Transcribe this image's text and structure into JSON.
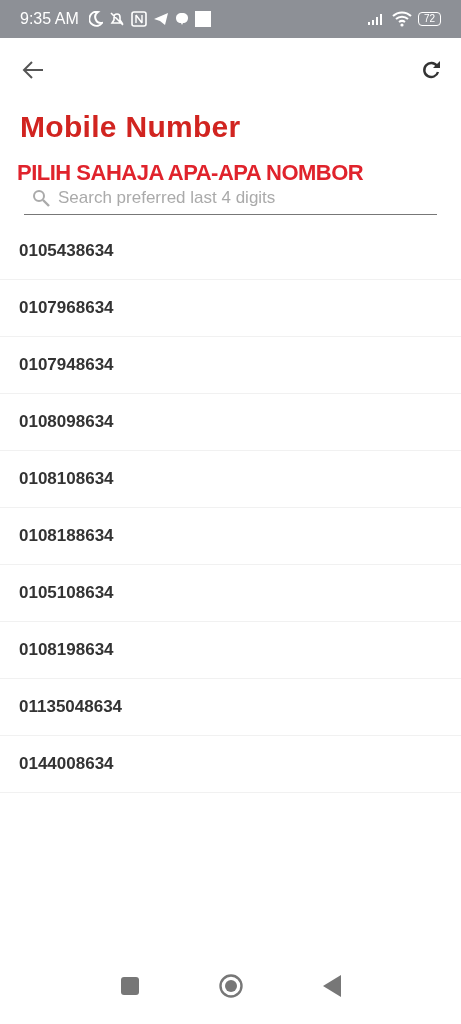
{
  "status_bar": {
    "time": "9:35 AM",
    "battery": "72"
  },
  "title": "Mobile Number",
  "subtitle": "PILIH SAHAJA APA-APA NOMBOR",
  "search": {
    "placeholder": "Search preferred last 4 digits"
  },
  "numbers": [
    "0105438634",
    "0107968634",
    "0107948634",
    "0108098634",
    "0108108634",
    "0108188634",
    "0105108634",
    "0108198634",
    "01135048634",
    "0144008634"
  ]
}
